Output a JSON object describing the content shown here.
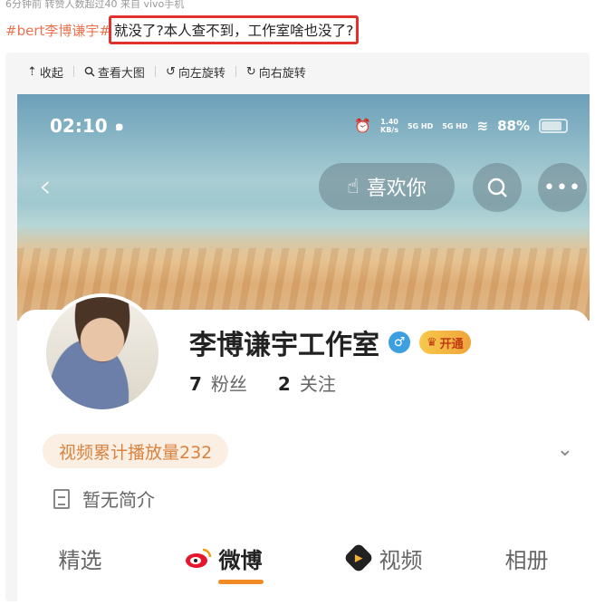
{
  "post": {
    "meta": "6分钟前 转赞人数超过40  来自 vivo手机",
    "hashtag": "#bert李博谦宇#",
    "text": "就没了?本人查不到，工作室啥也没了?"
  },
  "toolbar": {
    "items": [
      {
        "icon": "collapse-icon",
        "label": "收起"
      },
      {
        "icon": "search-icon",
        "label": "查看大图"
      },
      {
        "icon": "rotate-left-icon",
        "label": "向左旋转"
      },
      {
        "icon": "rotate-right-icon",
        "label": "向右旋转"
      }
    ]
  },
  "phone": {
    "status": {
      "time": "02:10",
      "speed": "1.40",
      "speed_unit": "KB/s",
      "net1": "5G HD",
      "net2": "5G HD",
      "battery": "88%"
    },
    "like_label": "喜欢你",
    "profile": {
      "name": "李博谦宇工作室",
      "badge_open": "开通",
      "fans_count": "7",
      "fans_label": "粉丝",
      "follow_count": "2",
      "follow_label": "关注",
      "play_count": "视频累计播放量232",
      "intro": "暂无简介"
    },
    "tabs": [
      "精选",
      "微博",
      "视频",
      "相册"
    ]
  },
  "colors": {
    "highlight_border": "#e0312c",
    "hashtag": "#eb7350",
    "accent": "#f08b26"
  }
}
